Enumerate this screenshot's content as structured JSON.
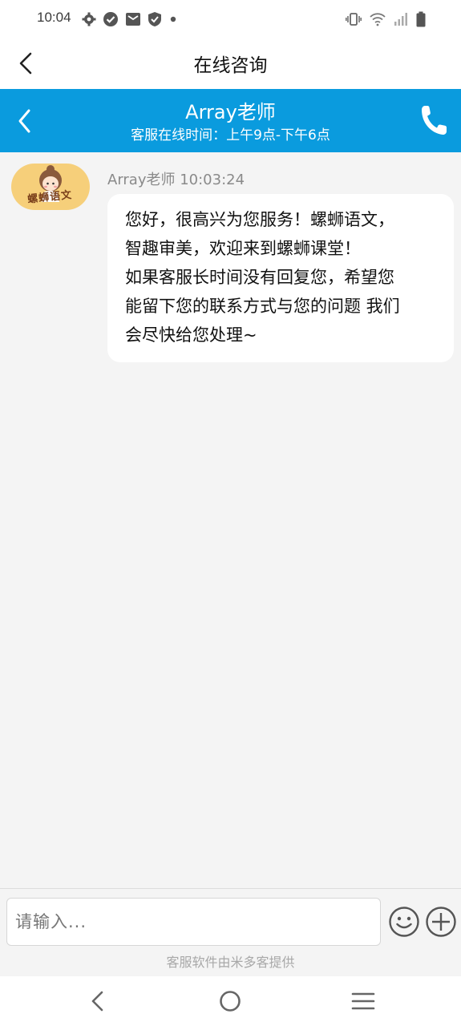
{
  "status_bar": {
    "time": "10:04",
    "left_icons": [
      "gear-icon",
      "check-circle-icon",
      "mail-icon",
      "shield-icon",
      "dot-icon"
    ],
    "right_icons": [
      "vibrate-icon",
      "wifi-icon",
      "signal-icon",
      "battery-icon"
    ]
  },
  "title_bar": {
    "title": "在线咨询"
  },
  "chat_header": {
    "agent_name": "Array老师",
    "online_hours": "客服在线时间：上午9点-下午6点",
    "color": "#0a9bde"
  },
  "messages": [
    {
      "sender": "Array老师",
      "time": "10:03:24",
      "meta": "Array老师 10:03:24",
      "avatar_text": "螺蛳语文",
      "text": "您好，很高兴为您服务！螺蛳语文，\n智趣审美，欢迎来到螺蛳课堂！\n如果客服长时间没有回复您，希望您\n能留下您的联系方式与您的问题 我们\n会尽快给您处理~"
    }
  ],
  "input": {
    "placeholder": "请输入...",
    "value": ""
  },
  "footer": {
    "powered_by": "客服软件由米多客提供"
  },
  "nav_bar": {
    "buttons": [
      "back-icon",
      "home-icon",
      "menu-icon"
    ]
  }
}
